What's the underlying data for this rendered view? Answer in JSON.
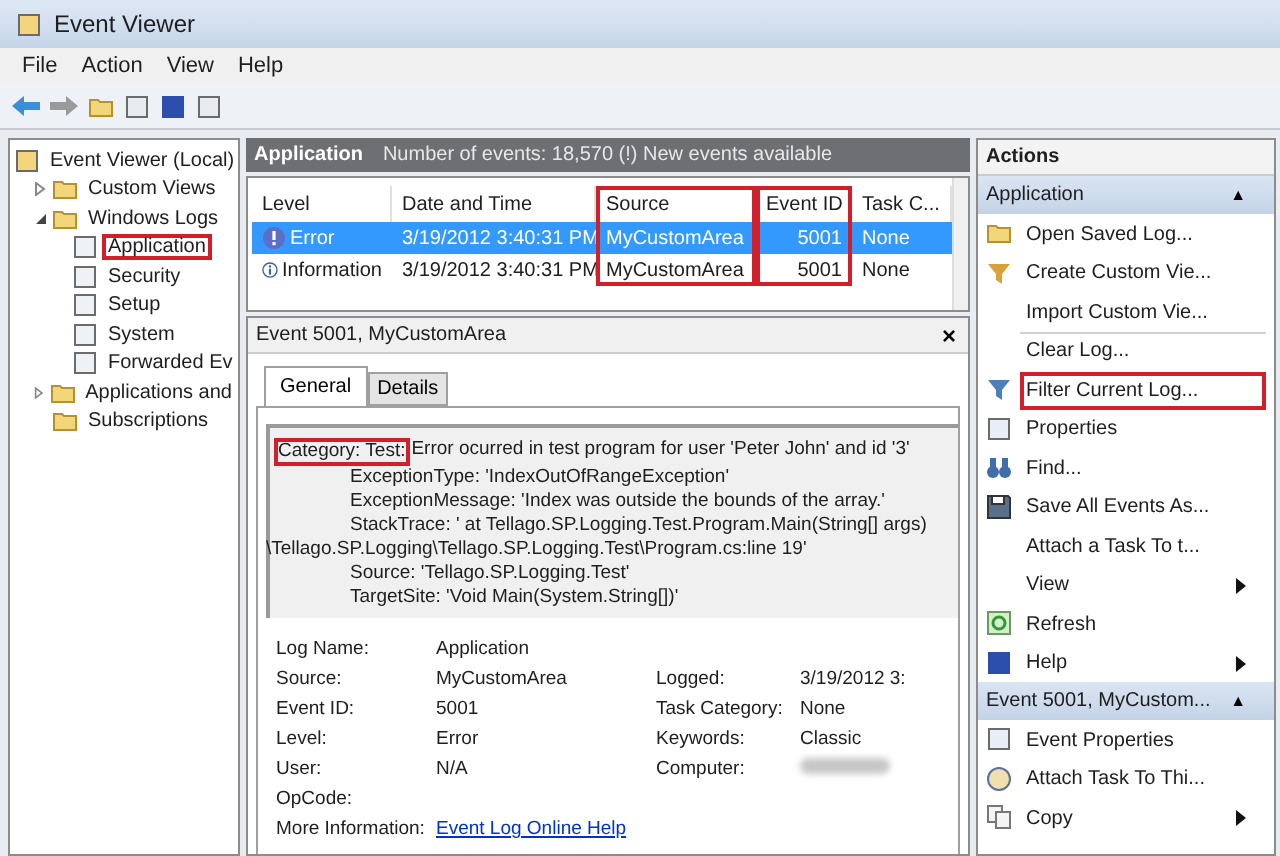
{
  "window": {
    "title": "Event Viewer"
  },
  "menu": [
    "File",
    "Action",
    "View",
    "Help"
  ],
  "tree": [
    {
      "label": "Event Viewer (Local)",
      "highlighted": false,
      "children": [
        {
          "label": "Custom Views",
          "expanded": false,
          "highlighted": false
        },
        {
          "label": "Windows Logs",
          "expanded": true,
          "highlighted": false,
          "children": [
            {
              "label": "Application",
              "highlighted": true
            },
            {
              "label": "Security",
              "highlighted": false
            },
            {
              "label": "Setup",
              "highlighted": false
            },
            {
              "label": "System",
              "highlighted": false
            },
            {
              "label": "Forwarded Ev",
              "highlighted": false
            }
          ]
        },
        {
          "label": "Applications and",
          "expanded": false,
          "highlighted": false
        },
        {
          "label": "Subscriptions",
          "highlighted": false
        }
      ]
    }
  ],
  "log_header": {
    "title": "Application",
    "info": "Number of events: 18,570 (!) New events available"
  },
  "events": {
    "columns": [
      {
        "label": "Level",
        "highlighted": false
      },
      {
        "label": "Date and Time",
        "highlighted": false
      },
      {
        "label": "Source",
        "highlighted": true
      },
      {
        "label": "Event ID",
        "highlighted": true
      },
      {
        "label": "Task C...",
        "highlighted": false
      }
    ],
    "rows": [
      {
        "kind": "error",
        "selected": true,
        "cells": [
          "Error",
          "3/19/2012 3:40:31 PM",
          "MyCustomArea",
          "5001",
          "None"
        ]
      },
      {
        "kind": "information",
        "selected": false,
        "cells": [
          "Information",
          "3/19/2012 3:40:31 PM",
          "MyCustomArea",
          "5001",
          "None"
        ]
      }
    ]
  },
  "detail": {
    "title": "Event 5001, MyCustomArea",
    "close": "×",
    "tabs": [
      {
        "label": "General",
        "selected": true
      },
      {
        "label": "Details",
        "selected": false
      }
    ],
    "message": {
      "category": "Category: Test:",
      "category_highlighted": true,
      "first_line": "Error ocurred in test program for user 'Peter John' and id '3'",
      "lines": [
        {
          "indent": true,
          "text": "ExceptionType: 'IndexOutOfRangeException'"
        },
        {
          "indent": true,
          "text": "ExceptionMessage: 'Index was outside the bounds of the array.'"
        },
        {
          "indent": true,
          "text": "StackTrace: '    at Tellago.SP.Logging.Test.Program.Main(String[] args)"
        },
        {
          "indent": false,
          "text": "\\Tellago.SP.Logging\\Tellago.SP.Logging.Test\\Program.cs:line 19'"
        },
        {
          "indent": true,
          "text": "Source: 'Tellago.SP.Logging.Test'"
        },
        {
          "indent": true,
          "text": "TargetSite: 'Void Main(System.String[])'"
        }
      ]
    },
    "properties": [
      {
        "label": "Log Name:",
        "value": "Application"
      },
      {
        "label": "Source:",
        "value": "MyCustomArea",
        "label2": "Logged:",
        "value2": "3/19/2012 3:"
      },
      {
        "label": "Event ID:",
        "value": "5001",
        "label2": "Task Category:",
        "value2": "None"
      },
      {
        "label": "Level:",
        "value": "Error",
        "label2": "Keywords:",
        "value2": "Classic"
      },
      {
        "label": "User:",
        "value": "N/A",
        "label2": "Computer:",
        "redacted": true
      },
      {
        "label": "OpCode:"
      },
      {
        "label": "More Information:",
        "link": "Event Log Online Help"
      }
    ]
  },
  "actions": {
    "title": "Actions",
    "sections": [
      {
        "title": "Application",
        "collapse": "▲",
        "items": [
          {
            "label": "Open Saved Log...",
            "highlighted": false,
            "submenu": false,
            "separator_before": false
          },
          {
            "label": "Create Custom Vie...",
            "highlighted": false,
            "submenu": false,
            "separator_before": false
          },
          {
            "label": "Import Custom Vie...",
            "highlighted": false,
            "submenu": false,
            "separator_before": false
          },
          {
            "label": "Clear Log...",
            "highlighted": false,
            "submenu": false,
            "separator_before": true
          },
          {
            "label": "Filter Current Log...",
            "highlighted": true,
            "submenu": false,
            "separator_before": false
          },
          {
            "label": "Properties",
            "highlighted": false,
            "submenu": false,
            "separator_before": false
          },
          {
            "label": "Find...",
            "highlighted": false,
            "submenu": false,
            "separator_before": false
          },
          {
            "label": "Save All Events As...",
            "highlighted": false,
            "submenu": false,
            "separator_before": false
          },
          {
            "label": "Attach a Task To t...",
            "highlighted": false,
            "submenu": false,
            "separator_before": false
          },
          {
            "label": "View",
            "highlighted": false,
            "submenu": true,
            "separator_before": false
          },
          {
            "label": "Refresh",
            "highlighted": false,
            "submenu": false,
            "separator_before": false
          },
          {
            "label": "Help",
            "highlighted": false,
            "submenu": true,
            "separator_before": false
          }
        ]
      },
      {
        "title": "Event 5001, MyCustom...",
        "collapse": "▲",
        "items": [
          {
            "label": "Event Properties",
            "highlighted": false,
            "submenu": false,
            "separator_before": false
          },
          {
            "label": "Attach Task To Thi...",
            "highlighted": false,
            "submenu": false,
            "separator_before": false
          },
          {
            "label": "Copy",
            "highlighted": false,
            "submenu": true,
            "separator_before": false
          }
        ]
      }
    ]
  }
}
